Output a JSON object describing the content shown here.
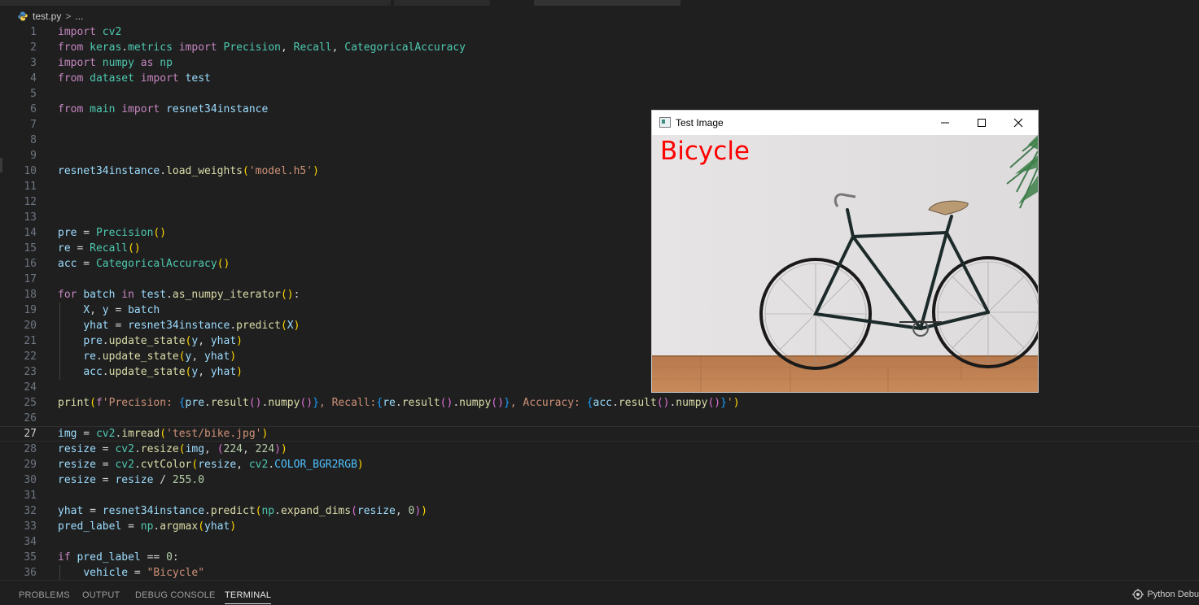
{
  "breadcrumb": {
    "file": "test.py",
    "separator": ">",
    "more": "..."
  },
  "editor": {
    "current_line": 27,
    "lines": [
      {
        "n": "1",
        "tokens": [
          [
            "kw",
            "import"
          ],
          [
            "op",
            " "
          ],
          [
            "mod",
            "cv2"
          ]
        ]
      },
      {
        "n": "2",
        "tokens": [
          [
            "kw",
            "from"
          ],
          [
            "op",
            " "
          ],
          [
            "mod",
            "keras"
          ],
          [
            "op",
            "."
          ],
          [
            "mod",
            "metrics"
          ],
          [
            "op",
            " "
          ],
          [
            "kw",
            "import"
          ],
          [
            "op",
            " "
          ],
          [
            "mod",
            "Precision"
          ],
          [
            "op",
            ", "
          ],
          [
            "mod",
            "Recall"
          ],
          [
            "op",
            ", "
          ],
          [
            "mod",
            "CategoricalAccuracy"
          ]
        ]
      },
      {
        "n": "3",
        "tokens": [
          [
            "kw",
            "import"
          ],
          [
            "op",
            " "
          ],
          [
            "mod",
            "numpy"
          ],
          [
            "op",
            " "
          ],
          [
            "kw",
            "as"
          ],
          [
            "op",
            " "
          ],
          [
            "mod",
            "np"
          ]
        ]
      },
      {
        "n": "4",
        "tokens": [
          [
            "kw",
            "from"
          ],
          [
            "op",
            " "
          ],
          [
            "mod",
            "dataset"
          ],
          [
            "op",
            " "
          ],
          [
            "kw",
            "import"
          ],
          [
            "op",
            " "
          ],
          [
            "var",
            "test"
          ]
        ]
      },
      {
        "n": "5",
        "tokens": []
      },
      {
        "n": "6",
        "tokens": [
          [
            "kw",
            "from"
          ],
          [
            "op",
            " "
          ],
          [
            "mod",
            "main"
          ],
          [
            "op",
            " "
          ],
          [
            "kw",
            "import"
          ],
          [
            "op",
            " "
          ],
          [
            "var",
            "resnet34instance"
          ]
        ]
      },
      {
        "n": "7",
        "tokens": []
      },
      {
        "n": "8",
        "tokens": []
      },
      {
        "n": "9",
        "tokens": []
      },
      {
        "n": "10",
        "tokens": [
          [
            "var",
            "resnet34instance"
          ],
          [
            "op",
            "."
          ],
          [
            "fn",
            "load_weights"
          ],
          [
            "b1",
            "("
          ],
          [
            "str",
            "'model.h5'"
          ],
          [
            "b1",
            ")"
          ]
        ]
      },
      {
        "n": "11",
        "tokens": []
      },
      {
        "n": "12",
        "tokens": []
      },
      {
        "n": "13",
        "tokens": []
      },
      {
        "n": "14",
        "tokens": [
          [
            "var",
            "pre"
          ],
          [
            "op",
            " = "
          ],
          [
            "mod",
            "Precision"
          ],
          [
            "b1",
            "()"
          ]
        ]
      },
      {
        "n": "15",
        "tokens": [
          [
            "var",
            "re"
          ],
          [
            "op",
            " = "
          ],
          [
            "mod",
            "Recall"
          ],
          [
            "b1",
            "()"
          ]
        ]
      },
      {
        "n": "16",
        "tokens": [
          [
            "var",
            "acc"
          ],
          [
            "op",
            " = "
          ],
          [
            "mod",
            "CategoricalAccuracy"
          ],
          [
            "b1",
            "()"
          ]
        ]
      },
      {
        "n": "17",
        "tokens": []
      },
      {
        "n": "18",
        "tokens": [
          [
            "kw",
            "for"
          ],
          [
            "op",
            " "
          ],
          [
            "var",
            "batch"
          ],
          [
            "op",
            " "
          ],
          [
            "kw",
            "in"
          ],
          [
            "op",
            " "
          ],
          [
            "var",
            "test"
          ],
          [
            "op",
            "."
          ],
          [
            "fn",
            "as_numpy_iterator"
          ],
          [
            "b1",
            "()"
          ],
          [
            "op",
            ":"
          ]
        ]
      },
      {
        "n": "19",
        "indent": true,
        "tokens": [
          [
            "op",
            "    "
          ],
          [
            "var",
            "X"
          ],
          [
            "op",
            ", "
          ],
          [
            "var",
            "y"
          ],
          [
            "op",
            " = "
          ],
          [
            "var",
            "batch"
          ]
        ]
      },
      {
        "n": "20",
        "indent": true,
        "tokens": [
          [
            "op",
            "    "
          ],
          [
            "var",
            "yhat"
          ],
          [
            "op",
            " = "
          ],
          [
            "var",
            "resnet34instance"
          ],
          [
            "op",
            "."
          ],
          [
            "fn",
            "predict"
          ],
          [
            "b1",
            "("
          ],
          [
            "var",
            "X"
          ],
          [
            "b1",
            ")"
          ]
        ]
      },
      {
        "n": "21",
        "indent": true,
        "tokens": [
          [
            "op",
            "    "
          ],
          [
            "var",
            "pre"
          ],
          [
            "op",
            "."
          ],
          [
            "fn",
            "update_state"
          ],
          [
            "b1",
            "("
          ],
          [
            "var",
            "y"
          ],
          [
            "op",
            ", "
          ],
          [
            "var",
            "yhat"
          ],
          [
            "b1",
            ")"
          ]
        ]
      },
      {
        "n": "22",
        "indent": true,
        "tokens": [
          [
            "op",
            "    "
          ],
          [
            "var",
            "re"
          ],
          [
            "op",
            "."
          ],
          [
            "fn",
            "update_state"
          ],
          [
            "b1",
            "("
          ],
          [
            "var",
            "y"
          ],
          [
            "op",
            ", "
          ],
          [
            "var",
            "yhat"
          ],
          [
            "b1",
            ")"
          ]
        ]
      },
      {
        "n": "23",
        "indent": true,
        "tokens": [
          [
            "op",
            "    "
          ],
          [
            "var",
            "acc"
          ],
          [
            "op",
            "."
          ],
          [
            "fn",
            "update_state"
          ],
          [
            "b1",
            "("
          ],
          [
            "var",
            "y"
          ],
          [
            "op",
            ", "
          ],
          [
            "var",
            "yhat"
          ],
          [
            "b1",
            ")"
          ]
        ]
      },
      {
        "n": "24",
        "tokens": []
      },
      {
        "n": "25",
        "tokens": [
          [
            "fn",
            "print"
          ],
          [
            "b1",
            "("
          ],
          [
            "kw",
            "f"
          ],
          [
            "str",
            "'Precision: "
          ],
          [
            "b3",
            "{"
          ],
          [
            "var",
            "pre"
          ],
          [
            "op",
            "."
          ],
          [
            "fn",
            "result"
          ],
          [
            "b2",
            "()"
          ],
          [
            "op",
            "."
          ],
          [
            "fn",
            "numpy"
          ],
          [
            "b2",
            "()"
          ],
          [
            "b3",
            "}"
          ],
          [
            "str",
            ", Recall:"
          ],
          [
            "b3",
            "{"
          ],
          [
            "var",
            "re"
          ],
          [
            "op",
            "."
          ],
          [
            "fn",
            "result"
          ],
          [
            "b2",
            "()"
          ],
          [
            "op",
            "."
          ],
          [
            "fn",
            "numpy"
          ],
          [
            "b2",
            "()"
          ],
          [
            "b3",
            "}"
          ],
          [
            "str",
            ", Accuracy: "
          ],
          [
            "b3",
            "{"
          ],
          [
            "var",
            "acc"
          ],
          [
            "op",
            "."
          ],
          [
            "fn",
            "result"
          ],
          [
            "b2",
            "()"
          ],
          [
            "op",
            "."
          ],
          [
            "fn",
            "numpy"
          ],
          [
            "b2",
            "()"
          ],
          [
            "b3",
            "}"
          ],
          [
            "str",
            "'"
          ],
          [
            "b1",
            ")"
          ]
        ]
      },
      {
        "n": "26",
        "tokens": []
      },
      {
        "n": "27",
        "tokens": [
          [
            "var",
            "img"
          ],
          [
            "op",
            " = "
          ],
          [
            "mod",
            "cv2"
          ],
          [
            "op",
            "."
          ],
          [
            "fn",
            "imread"
          ],
          [
            "b1",
            "("
          ],
          [
            "str",
            "'test/bike.jpg'"
          ],
          [
            "b1",
            ")"
          ]
        ]
      },
      {
        "n": "28",
        "tokens": [
          [
            "var",
            "resize"
          ],
          [
            "op",
            " = "
          ],
          [
            "mod",
            "cv2"
          ],
          [
            "op",
            "."
          ],
          [
            "fn",
            "resize"
          ],
          [
            "b1",
            "("
          ],
          [
            "var",
            "img"
          ],
          [
            "op",
            ", "
          ],
          [
            "b2",
            "("
          ],
          [
            "num",
            "224"
          ],
          [
            "op",
            ", "
          ],
          [
            "num",
            "224"
          ],
          [
            "b2",
            ")"
          ],
          [
            "b1",
            ")"
          ]
        ]
      },
      {
        "n": "29",
        "tokens": [
          [
            "var",
            "resize"
          ],
          [
            "op",
            " = "
          ],
          [
            "mod",
            "cv2"
          ],
          [
            "op",
            "."
          ],
          [
            "fn",
            "cvtColor"
          ],
          [
            "b1",
            "("
          ],
          [
            "var",
            "resize"
          ],
          [
            "op",
            ", "
          ],
          [
            "mod",
            "cv2"
          ],
          [
            "op",
            "."
          ],
          [
            "cst",
            "COLOR_BGR2RGB"
          ],
          [
            "b1",
            ")"
          ]
        ]
      },
      {
        "n": "30",
        "tokens": [
          [
            "var",
            "resize"
          ],
          [
            "op",
            " = "
          ],
          [
            "var",
            "resize"
          ],
          [
            "op",
            " / "
          ],
          [
            "num",
            "255.0"
          ]
        ]
      },
      {
        "n": "31",
        "tokens": []
      },
      {
        "n": "32",
        "tokens": [
          [
            "var",
            "yhat"
          ],
          [
            "op",
            " = "
          ],
          [
            "var",
            "resnet34instance"
          ],
          [
            "op",
            "."
          ],
          [
            "fn",
            "predict"
          ],
          [
            "b1",
            "("
          ],
          [
            "mod",
            "np"
          ],
          [
            "op",
            "."
          ],
          [
            "fn",
            "expand_dims"
          ],
          [
            "b2",
            "("
          ],
          [
            "var",
            "resize"
          ],
          [
            "op",
            ", "
          ],
          [
            "num",
            "0"
          ],
          [
            "b2",
            ")"
          ],
          [
            "b1",
            ")"
          ]
        ]
      },
      {
        "n": "33",
        "tokens": [
          [
            "var",
            "pred_label"
          ],
          [
            "op",
            " = "
          ],
          [
            "mod",
            "np"
          ],
          [
            "op",
            "."
          ],
          [
            "fn",
            "argmax"
          ],
          [
            "b1",
            "("
          ],
          [
            "var",
            "yhat"
          ],
          [
            "b1",
            ")"
          ]
        ]
      },
      {
        "n": "34",
        "tokens": []
      },
      {
        "n": "35",
        "tokens": [
          [
            "kw",
            "if"
          ],
          [
            "op",
            " "
          ],
          [
            "var",
            "pred_label"
          ],
          [
            "op",
            " == "
          ],
          [
            "num",
            "0"
          ],
          [
            "op",
            ":"
          ]
        ]
      },
      {
        "n": "36",
        "indent": true,
        "tokens": [
          [
            "op",
            "    "
          ],
          [
            "var",
            "vehicle"
          ],
          [
            "op",
            " = "
          ],
          [
            "str",
            "\"Bicycle\""
          ]
        ]
      }
    ]
  },
  "panel": {
    "tabs": [
      {
        "label": "PROBLEMS",
        "active": false
      },
      {
        "label": "OUTPUT",
        "active": false
      },
      {
        "label": "DEBUG CONSOLE",
        "active": false
      },
      {
        "label": "TERMINAL",
        "active": true
      }
    ],
    "status_right": "Python Debu"
  },
  "image_window": {
    "title": "Test Image",
    "prediction": "Bicycle",
    "icon": "window-app-icon",
    "prediction_color": "#ff0000"
  },
  "colors": {
    "editor_bg": "#1f1f1f",
    "keyword": "#c586c0",
    "module": "#4ec9b0",
    "function": "#dcdcaa",
    "variable": "#9cdcfe",
    "string": "#ce9178",
    "number": "#b5cea8"
  }
}
